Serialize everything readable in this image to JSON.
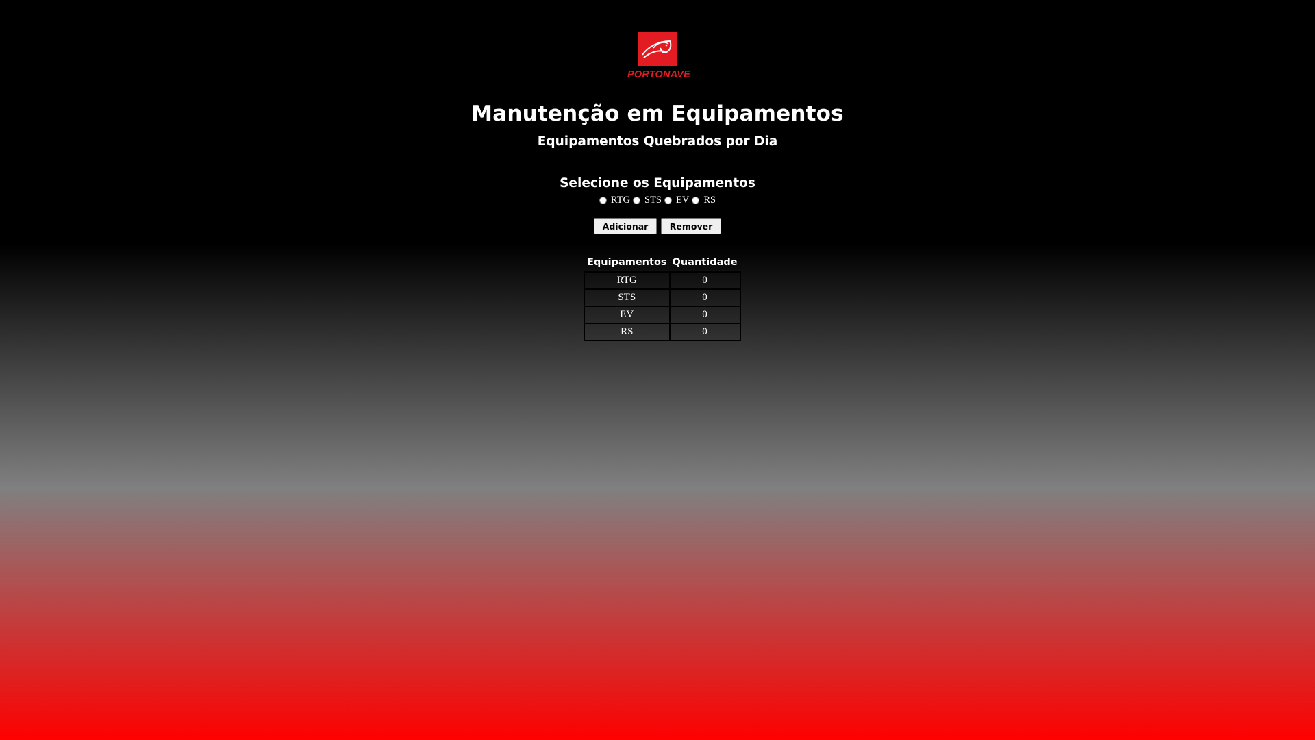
{
  "logo": {
    "brand_text": "PORTONAVE",
    "icon": "portonave-logo-icon",
    "color": "#e31b23"
  },
  "header": {
    "title": "Manutenção em Equipamentos",
    "subtitle": "Equipamentos Quebrados por Dia"
  },
  "selector": {
    "label": "Selecione os Equipamentos",
    "options": [
      {
        "label": "RTG",
        "checked": false
      },
      {
        "label": "STS",
        "checked": false
      },
      {
        "label": "EV",
        "checked": false
      },
      {
        "label": "RS",
        "checked": false
      }
    ]
  },
  "actions": {
    "add_label": "Adicionar",
    "remove_label": "Remover"
  },
  "table": {
    "headers": [
      "Equipamentos",
      "Quantidade"
    ],
    "rows": [
      {
        "equipment": "RTG",
        "quantity": "0"
      },
      {
        "equipment": "STS",
        "quantity": "0"
      },
      {
        "equipment": "EV",
        "quantity": "0"
      },
      {
        "equipment": "RS",
        "quantity": "0"
      }
    ]
  },
  "colors": {
    "gradient_top": "#000000",
    "gradient_mid": "#808080",
    "gradient_bottom": "#ff0000"
  }
}
